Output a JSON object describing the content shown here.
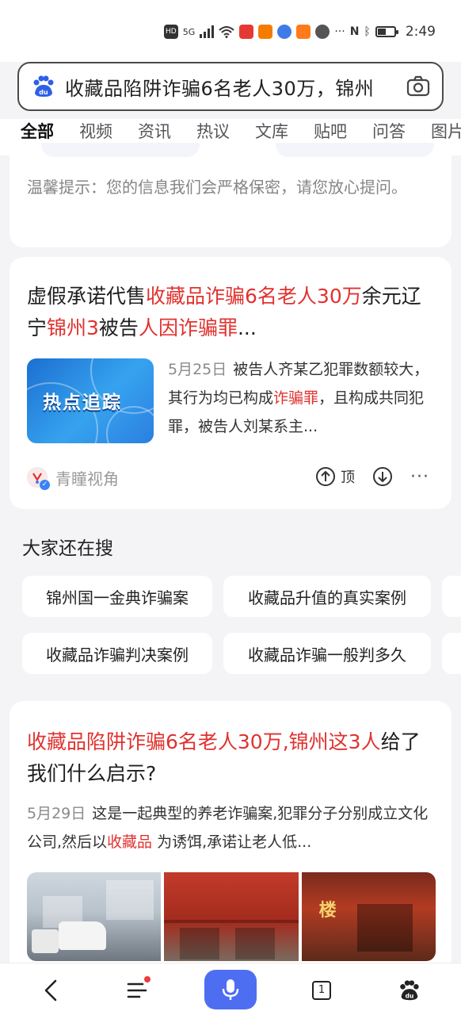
{
  "status_bar": {
    "hd": "HD",
    "net": "5G",
    "more": "···",
    "time": "2:49"
  },
  "search": {
    "query": "收藏品陷阱诈骗6名老人30万，锦州"
  },
  "tabs": [
    "全部",
    "视频",
    "资讯",
    "热议",
    "文库",
    "贴吧",
    "问答",
    "图片"
  ],
  "tip": {
    "text": "温馨提示：您的信息我们会严格保密，请您放心提问。"
  },
  "news1": {
    "title_a": "虚假承诺代售",
    "title_b": "收藏品诈骗6名老人30万",
    "title_c": "余元辽宁",
    "title_d": "锦州3",
    "title_e": "被告",
    "title_f": "人因诈骗罪",
    "title_g": "...",
    "thumb_label": "热点追踪",
    "date": "5月25日",
    "snippet_a": "被告人齐某乙犯罪数额较大，其行为均已构成",
    "snippet_hl": "诈骗罪",
    "snippet_b": "，且构成共同犯罪，被告人刘某系主...",
    "source": "青瞳视角",
    "top_label": "顶"
  },
  "people_search": {
    "title": "大家还在搜",
    "chips": [
      "锦州国一金典诈骗案",
      "收藏品升值的真实案例",
      "收藏品诈骗判决案例",
      "收藏品诈骗一般判多久"
    ]
  },
  "news2": {
    "title_hl": "收藏品陷阱诈骗6名老人30万,锦州这3人",
    "title_rest": "给了我们什么启示?",
    "date": "5月29日",
    "snippet_a": "这是一起典型的养老诈骗案,犯罪分子分别成立文化公司,然后以",
    "snippet_hl": "收藏品",
    "snippet_b": " 为诱饵,承诺让老人低..."
  },
  "bottom_nav": {
    "tab_count": "1"
  },
  "colors": {
    "accent": "#4e6ef2",
    "highlight": "#e0322f",
    "background": "#f4f4f6"
  }
}
